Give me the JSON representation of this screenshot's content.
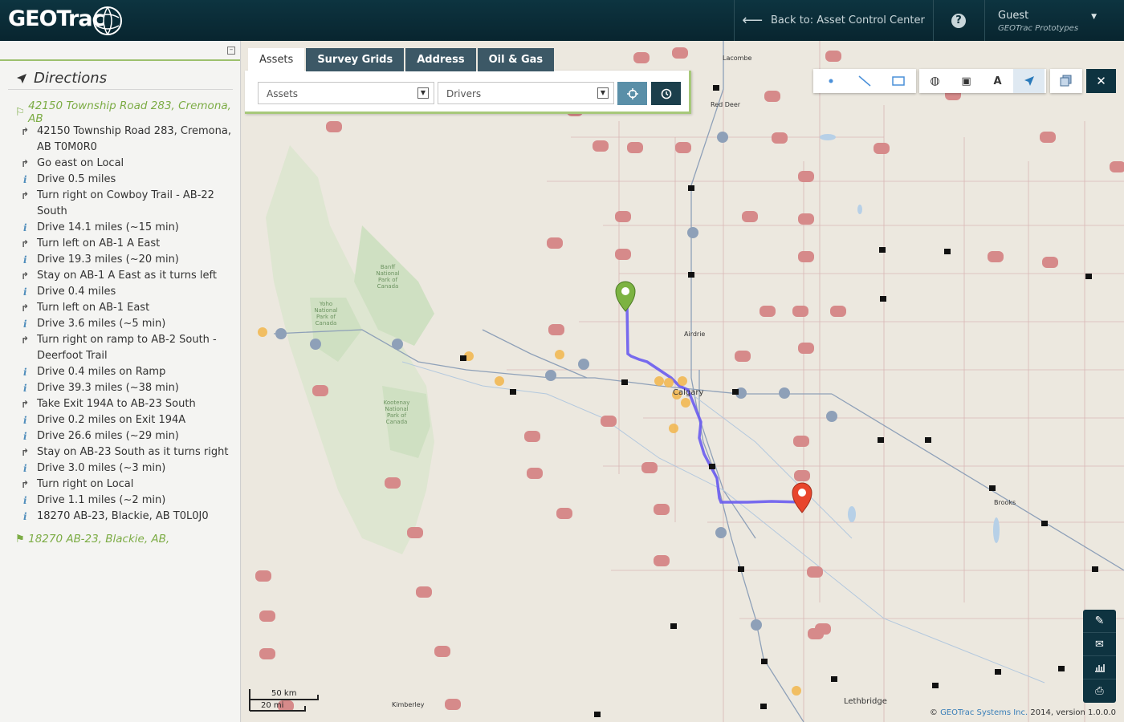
{
  "header": {
    "logo_text": "GEOTrac",
    "back_label": "Back to: Asset Control Center",
    "help_icon": "question-icon",
    "user_name": "Guest",
    "user_org": "GEOTrac Prototypes"
  },
  "sidebar": {
    "title": "Directions",
    "start": "42150 Township Road 283, Cremona, AB",
    "end": "18270 AB-23, Blackie, AB,",
    "steps": [
      {
        "icon": "turn",
        "text": "42150 Township Road 283, Cremona, AB T0M0R0"
      },
      {
        "icon": "turn",
        "text": "Go east on Local"
      },
      {
        "icon": "info",
        "text": "Drive 0.5 miles"
      },
      {
        "icon": "turn",
        "text": "Turn right on Cowboy Trail - AB-22 South"
      },
      {
        "icon": "info",
        "text": "Drive 14.1 miles (~15 min)"
      },
      {
        "icon": "turn",
        "text": "Turn left on AB-1 A East"
      },
      {
        "icon": "info",
        "text": "Drive 19.3 miles (~20 min)"
      },
      {
        "icon": "turn",
        "text": "Stay on AB-1 A East as it turns left"
      },
      {
        "icon": "info",
        "text": "Drive 0.4 miles"
      },
      {
        "icon": "turn",
        "text": "Turn left on AB-1 East"
      },
      {
        "icon": "info",
        "text": "Drive 3.6 miles (~5 min)"
      },
      {
        "icon": "turn",
        "text": "Turn right on ramp to AB-2 South - Deerfoot Trail"
      },
      {
        "icon": "info",
        "text": "Drive 0.4 miles on Ramp"
      },
      {
        "icon": "info",
        "text": "Drive 39.3 miles (~38 min)"
      },
      {
        "icon": "turn",
        "text": "Take Exit 194A to AB-23 South"
      },
      {
        "icon": "info",
        "text": "Drive 0.2 miles on Exit 194A"
      },
      {
        "icon": "info",
        "text": "Drive 26.6 miles (~29 min)"
      },
      {
        "icon": "turn",
        "text": "Stay on AB-23 South as it turns right"
      },
      {
        "icon": "info",
        "text": "Drive 3.0 miles (~3 min)"
      },
      {
        "icon": "turn",
        "text": "Turn right on Local"
      },
      {
        "icon": "info",
        "text": "Drive 1.1 miles (~2 min)"
      },
      {
        "icon": "info",
        "text": "18270 AB-23, Blackie, AB T0L0J0"
      }
    ]
  },
  "search": {
    "tabs": [
      "Assets",
      "Survey Grids",
      "Address",
      "Oil & Gas"
    ],
    "active_tab": "Assets",
    "asset_select": "Assets",
    "driver_select": "Drivers"
  },
  "map": {
    "cities": [
      "Lacombe",
      "Red Deer",
      "Airdrie",
      "Calgary",
      "Brooks",
      "Lethbridge",
      "Kimberley"
    ],
    "parks": [
      "Banff National Park of Canada",
      "Yoho National Park of Canada",
      "Kootenay National Park of Canada"
    ],
    "scale_km": "50 km",
    "scale_mi": "20 mi",
    "route_color": "#6a5cf0",
    "start_marker_color": "#7cb342",
    "end_marker_color": "#e8452c"
  },
  "footer": {
    "copyright": "©",
    "company": "GEOTrac Systems Inc.",
    "version": "2014, version 1.0.0.0"
  }
}
